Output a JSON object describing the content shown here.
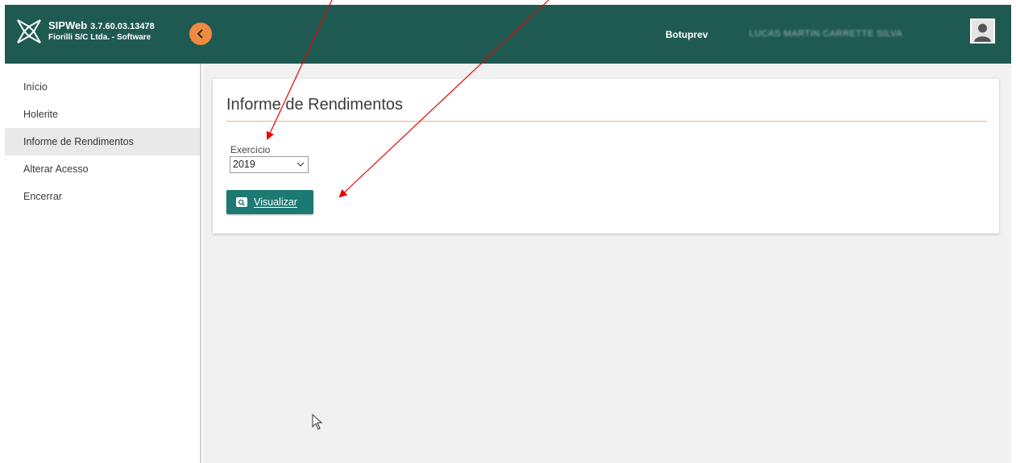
{
  "header": {
    "app_name": "SIPWeb",
    "version": "3.7.60.03.13478",
    "company": "Fiorilli S/C Ltda. - Software",
    "organization": "Botuprev",
    "user_name_blurred": "LUCAS MARTIN CARRETTE SILVA",
    "collapse_icon": "chevron-left-icon",
    "colors": {
      "header_bg": "#1f5a52",
      "accent": "#f08a3e"
    }
  },
  "sidebar": {
    "items": [
      {
        "label": "Início",
        "active": false
      },
      {
        "label": "Holerite",
        "active": false
      },
      {
        "label": "Informe de Rendimentos",
        "active": true
      },
      {
        "label": "Alterar Acesso",
        "active": false
      },
      {
        "label": "Encerrar",
        "active": false
      }
    ]
  },
  "main": {
    "title": "Informe de Rendimentos",
    "exercicio_label": "Exercício",
    "exercicio_value": "2019",
    "view_button_label": "Visualizar",
    "view_button_icon": "search-icon",
    "colors": {
      "button_bg": "#1d7a72",
      "divider": "#e8b48f"
    }
  },
  "annotations": {
    "arrows_color": "#e60000",
    "arrow_targets": [
      "exercicio-select",
      "visualizar-button"
    ]
  }
}
